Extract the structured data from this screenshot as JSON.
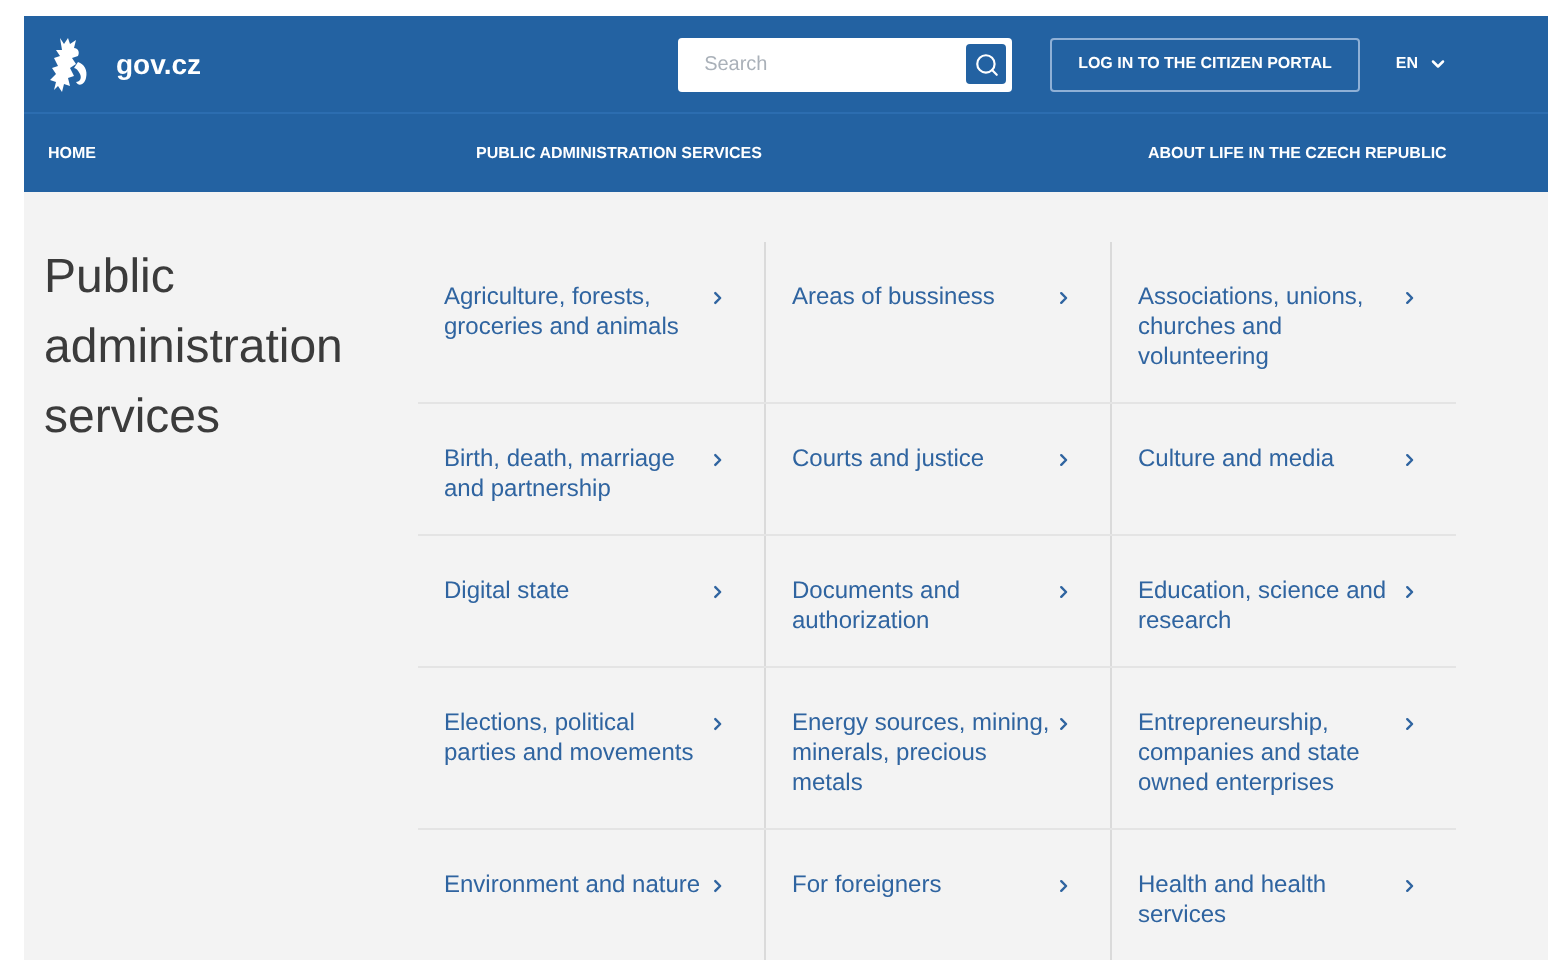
{
  "header": {
    "logo_text": "gov.cz",
    "search": {
      "placeholder": "Search"
    },
    "login_button": "LOG IN TO THE CITIZEN PORTAL",
    "language": "EN"
  },
  "nav": [
    "HOME",
    "PUBLIC ADMINISTRATION SERVICES",
    "ABOUT LIFE IN THE CZECH REPUBLIC"
  ],
  "page_title": "Public administration services",
  "services": [
    [
      "Agriculture, forests, groceries and animals",
      "Areas of bussiness",
      "Associations, unions, churches and volunteering"
    ],
    [
      "Birth, death, marriage and partnership",
      "Courts and justice",
      "Culture and media"
    ],
    [
      "Digital state",
      "Documents and authorization",
      "Education, science and research"
    ],
    [
      "Elections, political parties and movements",
      "Energy sources, mining, minerals, precious metals",
      "Entrepreneurship, companies and state owned enterprises"
    ],
    [
      "Environment and nature",
      "For foreigners",
      "Health and health services"
    ]
  ]
}
